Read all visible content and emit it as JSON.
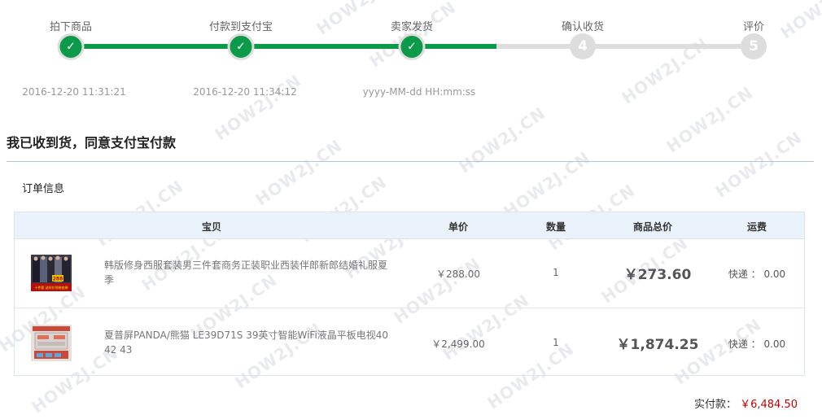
{
  "steps": [
    {
      "label": "拍下商品",
      "time": "2016-12-20 11:31:21",
      "status": "done"
    },
    {
      "label": "付款到支付宝",
      "time": "2016-12-20 11:34:12",
      "status": "done"
    },
    {
      "label": "卖家发货",
      "time": "yyyy-MM-dd HH:mm:ss",
      "status": "done"
    },
    {
      "label": "确认收货",
      "number": "4",
      "status": "todo"
    },
    {
      "label": "评价",
      "number": "5",
      "status": "todo"
    }
  ],
  "check_glyph": "✓",
  "confirm_title": "我已收到货，同意支付宝付款",
  "section_title": "订单信息",
  "table": {
    "headers": {
      "product": "宝贝",
      "price": "单价",
      "qty": "数量",
      "subtotal": "商品总价",
      "shipping": "运费"
    },
    "rows": [
      {
        "name": "韩版修身西服套装男三件套商务正装职业西装伴郎新郎结婚礼服夏季",
        "price": "￥288.00",
        "qty": "1",
        "subtotal": "￥273.60",
        "shipping": "快递 ： 0.00",
        "thumb_badge": "288",
        "thumb_caption": "十件套 送衬衫领带皮带"
      },
      {
        "name": "夏普屏PANDA/熊猫 LE39D71S 39英寸智能WiFi液晶平板电视40 42 43",
        "price": "￥2,499.00",
        "qty": "1",
        "subtotal": "￥1,874.25",
        "shipping": "快递 ： 0.00"
      }
    ]
  },
  "paid": {
    "label": "实付款：",
    "amount": "￥6,484.50"
  },
  "watermark": "HOW2J.CN",
  "colors": {
    "progress_done": "#0a9a48",
    "progress_todo": "#dddddd",
    "price_red": "#c40000",
    "header_bg": "#eaf3fb"
  }
}
